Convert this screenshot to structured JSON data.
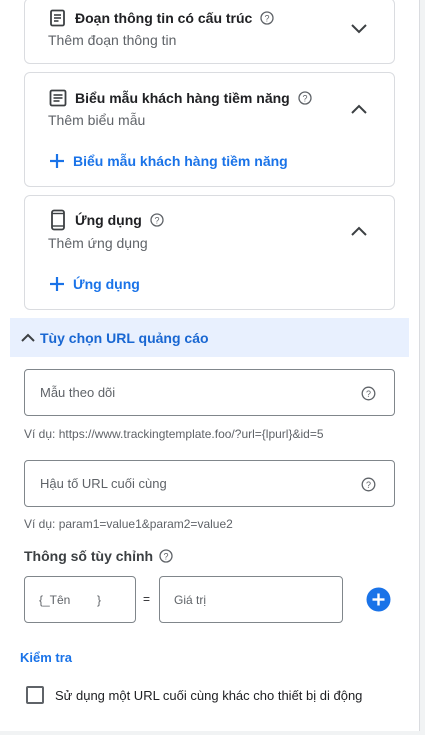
{
  "cards": {
    "structured": {
      "title": "Đoạn thông tin có cấu trúc",
      "subtitle": "Thêm đoạn thông tin"
    },
    "lead_form": {
      "title": "Biểu mẫu khách hàng tiềm năng",
      "subtitle": "Thêm biểu mẫu",
      "add_label": "Biểu mẫu khách hàng tiềm năng"
    },
    "app": {
      "title": "Ứng dụng",
      "subtitle": "Thêm ứng dụng",
      "add_label": "Ứng dụng"
    }
  },
  "url_options": {
    "section_label": "Tùy chọn URL quảng cáo",
    "tracking_template": {
      "placeholder": "Mẫu theo dõi",
      "value": "",
      "hint": "Ví dụ: https://www.trackingtemplate.foo/?url={lpurl}&id=5"
    },
    "final_url_suffix": {
      "placeholder": "Hậu tố URL cuối cùng",
      "value": "",
      "hint": "Ví dụ: param1=value1&param2=value2"
    },
    "custom_params": {
      "title": "Thông số tùy chỉnh",
      "name_placeholder": "{_Tên        }",
      "equals": "=",
      "value_placeholder": "Giá trị"
    },
    "test_link": "Kiểm tra",
    "mobile_url_checkbox": {
      "label": "Sử dụng một URL cuối cùng khác cho thiết bị di động",
      "checked": false
    }
  },
  "colors": {
    "accent": "#1a73e8",
    "section_bg": "#e8f0fe",
    "border": "#dadce0"
  }
}
